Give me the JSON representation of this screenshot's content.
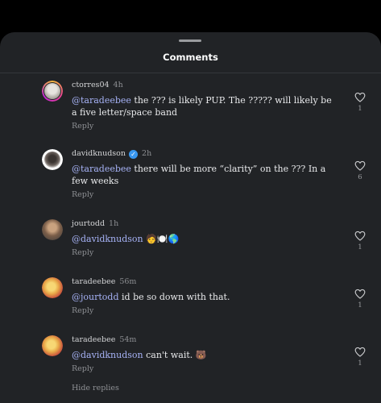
{
  "header": {
    "title": "Comments"
  },
  "comments": [
    {
      "username": "ctorres04",
      "time": "4h",
      "verified": false,
      "mention": "@taradeebee",
      "text": " the ??? is likely PUP. The ????? will likely be a five letter/space band",
      "reply_label": "Reply",
      "likes": "1"
    },
    {
      "username": "davidknudson",
      "time": "2h",
      "verified": true,
      "mention": "@taradeebee",
      "text": " there will be more “clarity” on the ??? In a few weeks",
      "reply_label": "Reply",
      "likes": "6"
    },
    {
      "username": "jourtodd",
      "time": "1h",
      "verified": false,
      "mention": "@davidknudson",
      "text": " 🧑🍽️🌎",
      "reply_label": "Reply",
      "likes": "1"
    },
    {
      "username": "taradeebee",
      "time": "56m",
      "verified": false,
      "mention": "@jourtodd",
      "text": " id be so down with that.",
      "reply_label": "Reply",
      "likes": "1"
    },
    {
      "username": "taradeebee",
      "time": "54m",
      "verified": false,
      "mention": "@davidknudson",
      "text": " can't wait. 🐻",
      "reply_label": "Reply",
      "likes": "1"
    }
  ],
  "footer": {
    "hide_replies": "Hide replies"
  },
  "colors": {
    "background": "#212326",
    "mention": "#a7b3f7",
    "verified": "#3897f0"
  },
  "icons": {
    "like": "heart-outline-icon",
    "verified": "verified-badge-icon"
  }
}
